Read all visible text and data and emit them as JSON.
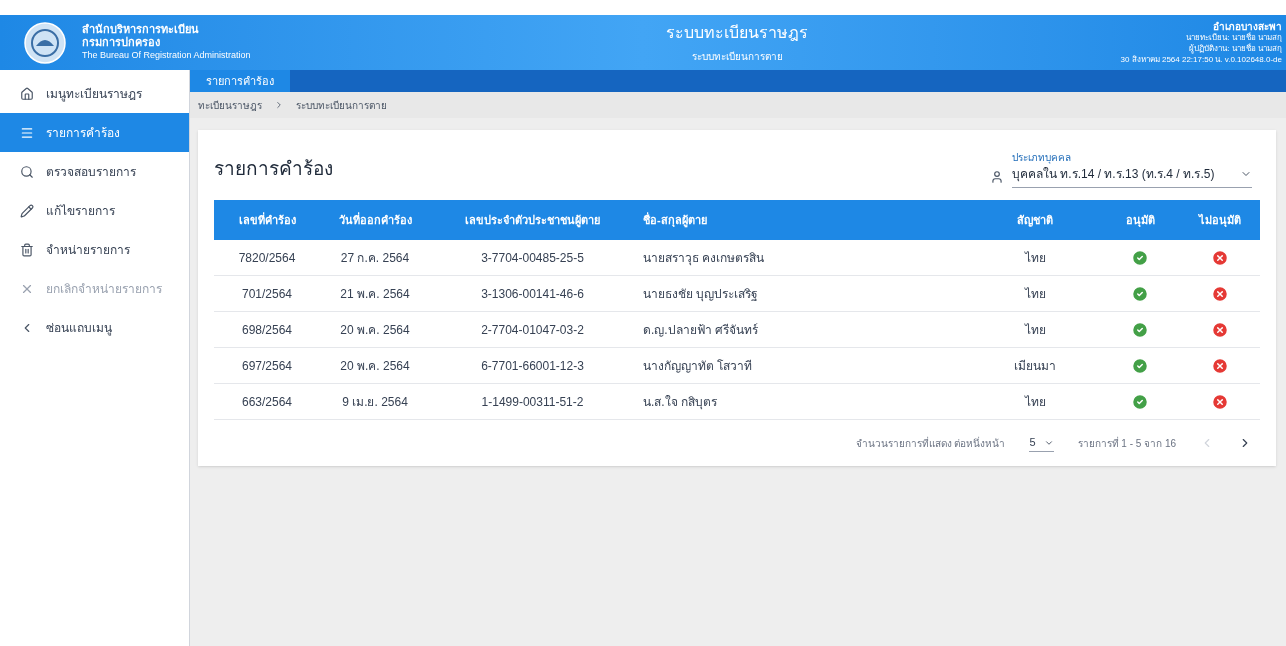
{
  "header": {
    "org_lines": [
      "สำนักบริหารการทะเบียน",
      "กรมการปกครอง",
      "The Bureau Of Registration Administration"
    ],
    "title": "ระบบทะเบียนราษฎร",
    "subtitle": "ระบบทะเบียนการตาย",
    "info_lines": [
      "อำเภอบางสะพา",
      "นายทะเบียน: นายชื่อ นามสกุ",
      "ผู้ปฏิบัติงาน: นายชื่อ นามสกุ",
      "30 สิงหาคม 2564 22:17:50 น.  v.0.102648.0-de"
    ]
  },
  "sidebar": {
    "items": [
      {
        "kind": "home",
        "label": "เมนูทะเบียนราษฎร",
        "selected": false,
        "disabled": false
      },
      {
        "kind": "list",
        "label": "รายการคำร้อง",
        "selected": true,
        "disabled": false
      },
      {
        "kind": "search",
        "label": "ตรวจสอบรายการ",
        "selected": false,
        "disabled": false
      },
      {
        "kind": "edit",
        "label": "แก้ไขรายการ",
        "selected": false,
        "disabled": false
      },
      {
        "kind": "trash",
        "label": "จำหน่ายรายการ",
        "selected": false,
        "disabled": false
      },
      {
        "kind": "cancel",
        "label": "ยกเลิกจำหน่ายรายการ",
        "selected": false,
        "disabled": true
      },
      {
        "kind": "collapse",
        "label": "ซ่อนแถบเมนู",
        "selected": false,
        "disabled": false
      }
    ]
  },
  "tabs": [
    {
      "label": "รายการคำร้อง",
      "selected": true
    }
  ],
  "breadcrumb": [
    "ทะเบียนราษฎร",
    "ระบบทะเบียนการตาย"
  ],
  "card": {
    "title": "รายการคำร้อง",
    "person_type": {
      "label": "ประเภทบุคคล",
      "value": "บุคคลใน ท.ร.14 / ท.ร.13 (ท.ร.4 / ท.ร.5)"
    }
  },
  "table": {
    "columns": [
      "เลขที่คำร้อง",
      "วันที่ออกคำร้อง",
      "เลขประจำตัวประชาชนผู้ตาย",
      "ชื่อ-สกุลผู้ตาย",
      "สัญชาติ",
      "อนุมัติ",
      "ไม่อนุมัติ"
    ],
    "rows": [
      [
        "7820/2564",
        "27 ก.ค. 2564",
        "3-7704-00485-25-5",
        "นายสราวุธ คงเกษตรสิน",
        "ไทย"
      ],
      [
        "701/2564",
        "21 พ.ค. 2564",
        "3-1306-00141-46-6",
        "นายธงชัย บุญประเสริฐ",
        "ไทย"
      ],
      [
        "698/2564",
        "20 พ.ค. 2564",
        "2-7704-01047-03-2",
        "ด.ญ.ปลายฟ้า ศรีจันทร์",
        "ไทย"
      ],
      [
        "697/2564",
        "20 พ.ค. 2564",
        "6-7701-66001-12-3",
        "นางกัญญาทัต โสวาที",
        "เมียนมา"
      ],
      [
        "663/2564",
        "9 เม.ย. 2564",
        "1-1499-00311-51-2",
        "น.ส.ใจ กสิบุตร",
        "ไทย"
      ]
    ]
  },
  "pagination": {
    "rows_per_page_label": "จำนวนรายการที่แสดง ต่อหนึ่งหน้า",
    "rows_per_page": "5",
    "range": "รายการที่ 1 - 5 จาก 16",
    "prev_disabled": true,
    "next_disabled": false
  }
}
